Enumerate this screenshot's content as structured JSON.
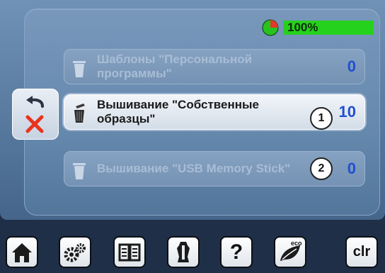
{
  "battery": {
    "level_text": "100%",
    "level_fraction": 1.0,
    "pie_color": "#e03a2a",
    "bar_color": "#26d11d"
  },
  "rows": [
    {
      "label": "Шаблоны \"Персональной\nпрограммы\"",
      "count": "0",
      "state": "disabled"
    },
    {
      "label": "Вышивание \"Собственные\nобразцы\"",
      "count": "10",
      "state": "selected"
    },
    {
      "label": "Вышивание \"USB Memory Stick\"",
      "count": "0",
      "state": "disabled"
    }
  ],
  "callouts": [
    "1",
    "2"
  ],
  "side": {
    "icons": [
      "undo-icon",
      "delete-icon"
    ]
  },
  "toolbar": {
    "icons": [
      "home-icon",
      "settings-icon",
      "tutorial-icon",
      "sewing-consultant-icon",
      "help-icon",
      "eco-icon"
    ],
    "help_label": "?",
    "eco_label": "eco",
    "clr_label": "clr"
  }
}
